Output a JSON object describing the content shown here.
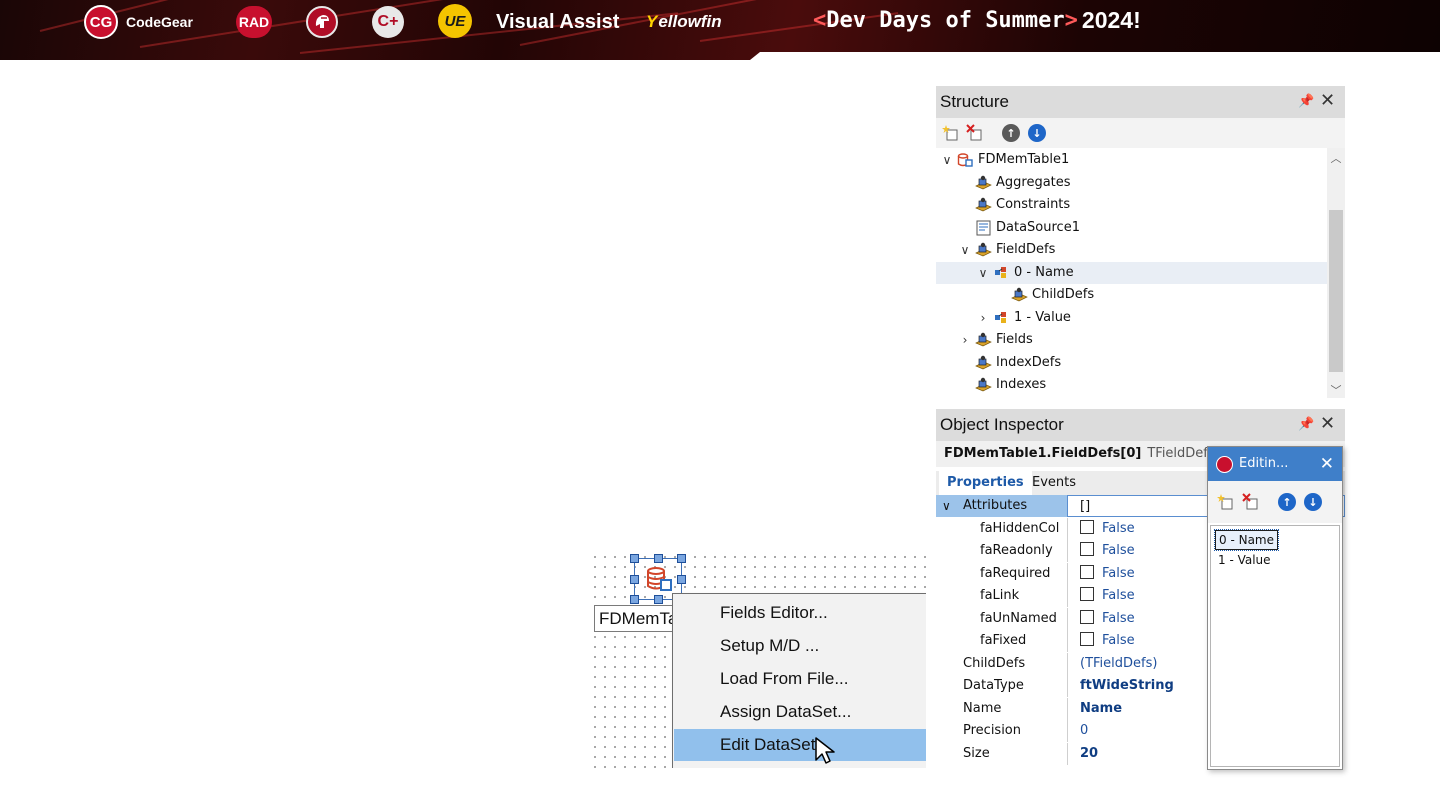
{
  "banner": {
    "codegear": "CodeGear",
    "cg_badge": "CG",
    "rad_badge": "RAD",
    "cpp_badge": "C+",
    "ue_badge": "UE",
    "visual_assist": "Visual Assist",
    "yellowfin_y": "Y",
    "yellowfin_rest": "ellowfin",
    "dev_open": "<",
    "dev_text": "Dev Days of Summer",
    "dev_close": ">",
    "year": "2024!"
  },
  "designer": {
    "component_label": "FDMemTable1",
    "menu": [
      {
        "label": "Fields Editor..."
      },
      {
        "label": "Setup M/D ..."
      },
      {
        "label": "Load From File..."
      },
      {
        "label": "Assign DataSet..."
      },
      {
        "label": "Edit DataSet..."
      }
    ],
    "highlighted_index": 4
  },
  "structure": {
    "title": "Structure",
    "tree": [
      {
        "label": "FDMemTable1",
        "depth": 0,
        "expander": "open",
        "icon": "table-icon"
      },
      {
        "label": "Aggregates",
        "depth": 1,
        "expander": "none",
        "icon": "collection-icon"
      },
      {
        "label": "Constraints",
        "depth": 1,
        "expander": "none",
        "icon": "collection-icon"
      },
      {
        "label": "DataSource1",
        "depth": 1,
        "expander": "none",
        "icon": "datasource-icon"
      },
      {
        "label": "FieldDefs",
        "depth": 1,
        "expander": "open",
        "icon": "collection-icon"
      },
      {
        "label": "0 - Name",
        "depth": 2,
        "expander": "open",
        "icon": "fielddef-icon",
        "selected": true
      },
      {
        "label": "ChildDefs",
        "depth": 3,
        "expander": "none",
        "icon": "collection-icon"
      },
      {
        "label": "1 - Value",
        "depth": 2,
        "expander": "closed",
        "icon": "fielddef-icon"
      },
      {
        "label": "Fields",
        "depth": 1,
        "expander": "closed",
        "icon": "collection-icon"
      },
      {
        "label": "IndexDefs",
        "depth": 1,
        "expander": "none",
        "icon": "collection-icon"
      },
      {
        "label": "Indexes",
        "depth": 1,
        "expander": "none",
        "icon": "collection-icon"
      }
    ]
  },
  "inspector": {
    "title": "Object Inspector",
    "object_name": "FDMemTable1.FieldDefs[0]",
    "object_type": "TFieldDef",
    "tabs": [
      "Properties",
      "Events"
    ],
    "properties": [
      {
        "name": "Attributes",
        "value": "[]",
        "kind": "set",
        "expander": "open",
        "selected": true
      },
      {
        "name": "faHiddenCol",
        "value": "False",
        "kind": "bool",
        "sub": true
      },
      {
        "name": "faReadonly",
        "value": "False",
        "kind": "bool",
        "sub": true
      },
      {
        "name": "faRequired",
        "value": "False",
        "kind": "bool",
        "sub": true
      },
      {
        "name": "faLink",
        "value": "False",
        "kind": "bool",
        "sub": true
      },
      {
        "name": "faUnNamed",
        "value": "False",
        "kind": "bool",
        "sub": true
      },
      {
        "name": "faFixed",
        "value": "False",
        "kind": "bool",
        "sub": true
      },
      {
        "name": "ChildDefs",
        "value": "(TFieldDefs)",
        "kind": "object"
      },
      {
        "name": "DataType",
        "value": "ftWideString",
        "kind": "bold"
      },
      {
        "name": "Name",
        "value": "Name",
        "kind": "bold"
      },
      {
        "name": "Precision",
        "value": "0",
        "kind": "plain"
      },
      {
        "name": "Size",
        "value": "20",
        "kind": "bold"
      }
    ]
  },
  "editor": {
    "title": "Editin...",
    "items": [
      "0 - Name",
      "1 - Value"
    ]
  }
}
